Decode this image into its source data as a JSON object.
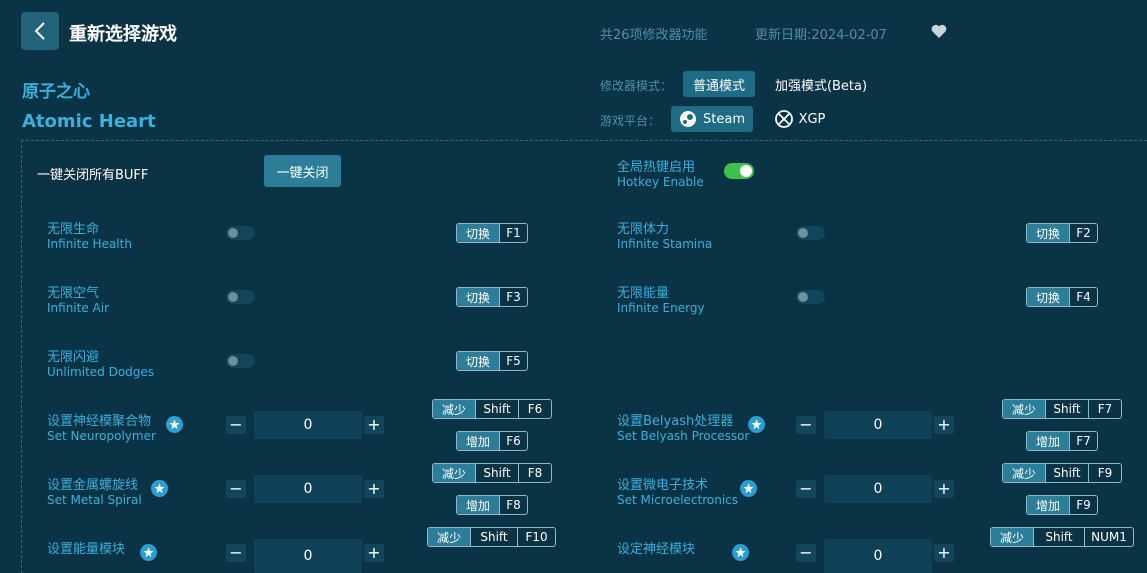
{
  "header": {
    "title": "重新选择游戏",
    "feature_count": "共26项修改器功能",
    "update_date": "更新日期:2024-02-07"
  },
  "game": {
    "name_cn": "原子之心",
    "name_en": "Atomic Heart"
  },
  "mode": {
    "label": "修改器模式：",
    "normal": "普通模式",
    "enhanced": "加强模式(Beta)"
  },
  "platform": {
    "label": "游戏平台：",
    "steam": "Steam",
    "xgp": "XGP"
  },
  "global": {
    "close_all_label": "一键关闭所有BUFF",
    "close_all_button": "一键关闭",
    "hotkey_cn": "全局热键启用",
    "hotkey_en": "Hotkey Enable",
    "hotkey_on": true
  },
  "hotkey_tags": {
    "toggle": "切换",
    "decrease": "减少",
    "increase": "增加",
    "shift": "Shift"
  },
  "toggles": [
    {
      "cn": "无限生命",
      "en": "Infinite Health",
      "key": "F1",
      "on": false
    },
    {
      "cn": "无限体力",
      "en": "Infinite Stamina",
      "key": "F2",
      "on": false
    },
    {
      "cn": "无限空气",
      "en": "Infinite Air",
      "key": "F3",
      "on": false
    },
    {
      "cn": "无限能量",
      "en": "Infinite Energy",
      "key": "F4",
      "on": false
    },
    {
      "cn": "无限闪避",
      "en": "Unlimited Dodges",
      "key": "F5",
      "on": false
    }
  ],
  "steppers": [
    {
      "cn": "设置神经模聚合物",
      "en": "Set Neuropolymer",
      "value": "0",
      "dec_key": "F6",
      "inc_key": "F6"
    },
    {
      "cn": "设置Belyash处理器",
      "en": "Set Belyash Processor",
      "value": "0",
      "dec_key": "F7",
      "inc_key": "F7"
    },
    {
      "cn": "设置金属螺旋线",
      "en": "Set Metal Spiral",
      "value": "0",
      "dec_key": "F8",
      "inc_key": "F8"
    },
    {
      "cn": "设置微电子技术",
      "en": "Set Microelectronics",
      "value": "0",
      "dec_key": "F9",
      "inc_key": "F9"
    },
    {
      "cn": "设置能量模块",
      "en": "",
      "value": "0",
      "dec_key": "F10",
      "inc_key": ""
    },
    {
      "cn": "设定神经模块",
      "en": "",
      "value": "0",
      "dec_key": "NUM1",
      "inc_key": ""
    }
  ],
  "colors": {
    "background": "#0a3346",
    "accent": "#3ab0dc",
    "toggle_on": "#3fc24d"
  }
}
